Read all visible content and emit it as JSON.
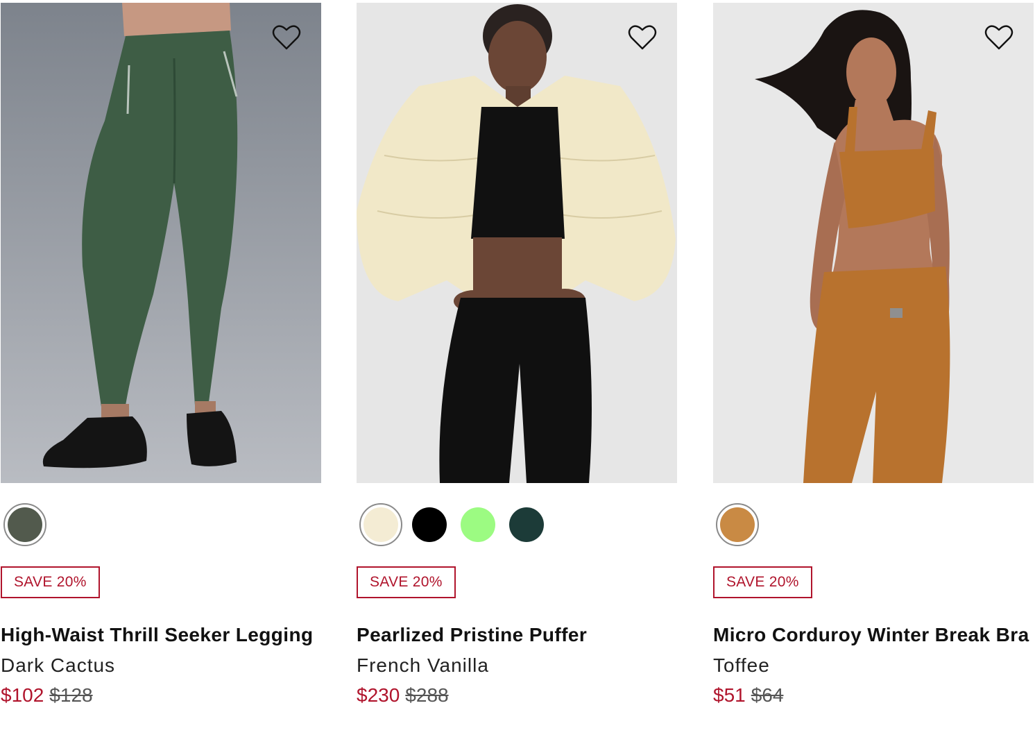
{
  "products": [
    {
      "name": "High-Waist Thrill Seeker Legging",
      "color": "Dark Cactus",
      "sale_price": "$102",
      "original_price": "$128",
      "badge": "SAVE 20%",
      "image_icon": "product-photo-legging",
      "swatches": [
        {
          "name": "Dark Cactus",
          "hex": "#525a4d",
          "selected": true
        }
      ]
    },
    {
      "name": "Pearlized Pristine Puffer",
      "color": "French Vanilla",
      "sale_price": "$230",
      "original_price": "$288",
      "badge": "SAVE 20%",
      "image_icon": "product-photo-puffer",
      "swatches": [
        {
          "name": "French Vanilla",
          "hex": "#f4ecd4",
          "selected": true
        },
        {
          "name": "Black",
          "hex": "#000000",
          "selected": false
        },
        {
          "name": "Green",
          "hex": "#9cfb82",
          "selected": false
        },
        {
          "name": "Dark Teal",
          "hex": "#1c3b38",
          "selected": false
        }
      ]
    },
    {
      "name": "Micro Corduroy Winter Break Bra",
      "color": "Toffee",
      "sale_price": "$51",
      "original_price": "$64",
      "badge": "SAVE 20%",
      "image_icon": "product-photo-bra",
      "swatches": [
        {
          "name": "Toffee",
          "hex": "#c98a44",
          "selected": true
        }
      ]
    }
  ],
  "colors": {
    "sale": "#b0142c",
    "text": "#111111",
    "strike": "#555555"
  },
  "icons": {
    "wishlist": "heart-outline-icon"
  }
}
